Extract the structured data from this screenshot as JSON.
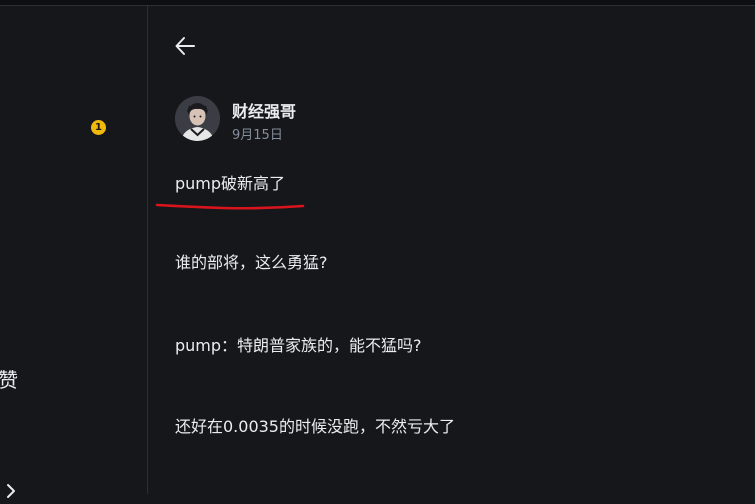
{
  "notifications": {
    "count": "1"
  },
  "left_panel": {
    "like_label": "赞"
  },
  "post": {
    "author": "财经强哥",
    "date": "9月15日",
    "paragraphs": [
      "pump破新高了",
      "谁的部将，这么勇猛?",
      "pump：特朗普家族的，能不猛吗?",
      "还好在0.0035的时候没跑，不然亏大了"
    ]
  },
  "icons": {
    "back": "arrow-left-icon",
    "chevron": "chevron-right-icon"
  },
  "colors": {
    "background": "#16171b",
    "text": "#eaecef",
    "muted": "#848e9c",
    "badge": "#f0b90b",
    "annotation": "#d9141c"
  }
}
